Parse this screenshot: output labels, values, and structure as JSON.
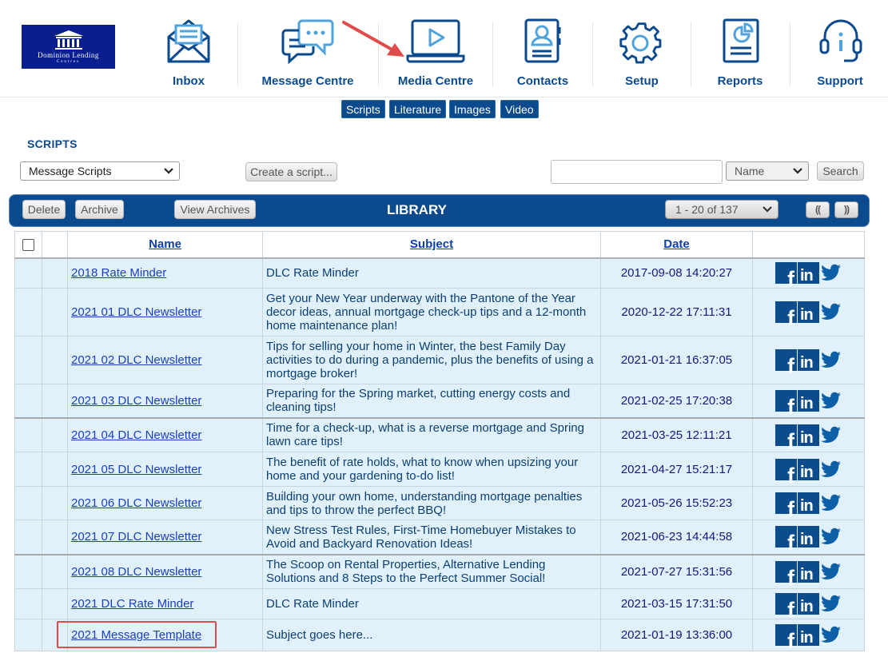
{
  "brand": {
    "line1": "Dominion Lending",
    "line2": "Centres"
  },
  "nav": [
    {
      "label": "Inbox",
      "icon": "envelope-icon"
    },
    {
      "label": "Message Centre",
      "icon": "chat-icon"
    },
    {
      "label": "Media Centre",
      "icon": "laptop-play-icon"
    },
    {
      "label": "Contacts",
      "icon": "address-book-icon"
    },
    {
      "label": "Setup",
      "icon": "gear-icon"
    },
    {
      "label": "Reports",
      "icon": "report-icon"
    },
    {
      "label": "Support",
      "icon": "headset-icon"
    }
  ],
  "subtabs": [
    "Scripts",
    "Literature",
    "Images",
    "Video"
  ],
  "section_title": "SCRIPTS",
  "controls": {
    "script_type": "Message Scripts",
    "create_label": "Create a script...",
    "search_value": "",
    "sort_by": "Name",
    "search_label": "Search"
  },
  "library": {
    "title": "LIBRARY",
    "delete_label": "Delete",
    "archive_label": "Archive",
    "view_archives_label": "View Archives",
    "pager": "1 - 20 of 137",
    "prev_label": "((",
    "next_label": "))"
  },
  "table": {
    "columns": [
      "Name",
      "Subject",
      "Date"
    ],
    "rows": [
      {
        "name": "2018 Rate Minder",
        "subject": "DLC Rate Minder",
        "date": "2017-09-08 14:20:27"
      },
      {
        "name": "2021 01 DLC Newsletter",
        "subject": "Get your New Year underway with the Pantone of the Year decor ideas, annual mortgage check-up tips and a 12-month home maintenance plan!",
        "date": "2020-12-22 17:11:31"
      },
      {
        "name": "2021 02 DLC Newsletter",
        "subject": "Tips for selling your home in Winter, the best Family Day activities to do during a pandemic, plus the benefits of using a mortgage broker!",
        "date": "2021-01-21 16:37:05"
      },
      {
        "name": "2021 03 DLC Newsletter",
        "subject": "Preparing for the Spring market, cutting energy costs and cleaning tips!",
        "date": "2021-02-25 17:20:38"
      },
      {
        "name": "2021 04 DLC Newsletter",
        "subject": "Time for a check-up, what is a reverse mortgage and Spring lawn care tips!",
        "date": "2021-03-25 12:11:21"
      },
      {
        "name": "2021 05 DLC Newsletter",
        "subject": "The benefit of rate holds, what to know when upsizing your home and your gardening to-do list!",
        "date": "2021-04-27 15:21:17"
      },
      {
        "name": "2021 06 DLC Newsletter",
        "subject": "Building your own home, understanding mortgage penalties and tips to throw the perfect BBQ!",
        "date": "2021-05-26 15:52:23"
      },
      {
        "name": "2021 07 DLC Newsletter",
        "subject": "New Stress Test Rules, First-Time Homebuyer Mistakes to Avoid and Backyard Renovation Ideas!",
        "date": "2021-06-23 14:44:58"
      },
      {
        "name": "2021 08 DLC Newsletter",
        "subject": "The Scoop on Rental Properties, Alternative Lending Solutions and 8 Steps to the Perfect Summer Social!",
        "date": "2021-07-27 15:31:56"
      },
      {
        "name": "2021 DLC Rate Minder",
        "subject": "DLC Rate Minder",
        "date": "2021-03-15 17:31:50"
      },
      {
        "name": "2021 Message Template",
        "subject": "Subject goes here...",
        "date": "2021-01-19 13:36:00"
      }
    ]
  },
  "colors": {
    "brand_blue": "#0b4a8c",
    "row_bg": "#e1f1fb",
    "highlight": "#e04b4b"
  }
}
